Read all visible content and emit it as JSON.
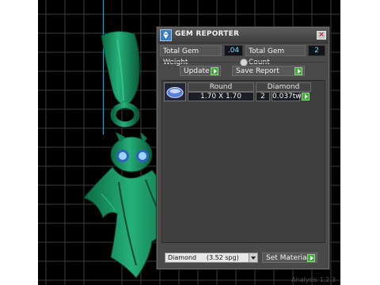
{
  "viewport": {
    "status_text": "Analysis 1.2.3"
  },
  "panel": {
    "title": "GEM REPORTER",
    "close_label": "×",
    "total_weight_label": "Total Gem Weight",
    "total_weight_value": ".04",
    "total_count_label": "Total Gem Count",
    "total_count_value": "2",
    "update_label": "Update",
    "save_report_label": "Save Report"
  },
  "gem_table": {
    "rows": [
      {
        "shape": "Round",
        "size": "1.70 X 1.70",
        "material": "Diamond",
        "count": "2",
        "weight": "0.037tw"
      }
    ]
  },
  "footer": {
    "material_selected": "Diamond     (3.52 spg)",
    "set_material_label": "Set Material"
  },
  "colors": {
    "viewport_bg": "#000000",
    "grid_line": "#444444",
    "model_green": "#0f8a5a",
    "panel_bg": "#4a4a4a",
    "value_text": "#7fdcff",
    "go_button": "#3fa93a"
  },
  "icons": [
    "gem-reporter-icon",
    "close-icon",
    "collapse-toggle-icon",
    "go-arrow-icon",
    "dropdown-arrow-icon"
  ]
}
